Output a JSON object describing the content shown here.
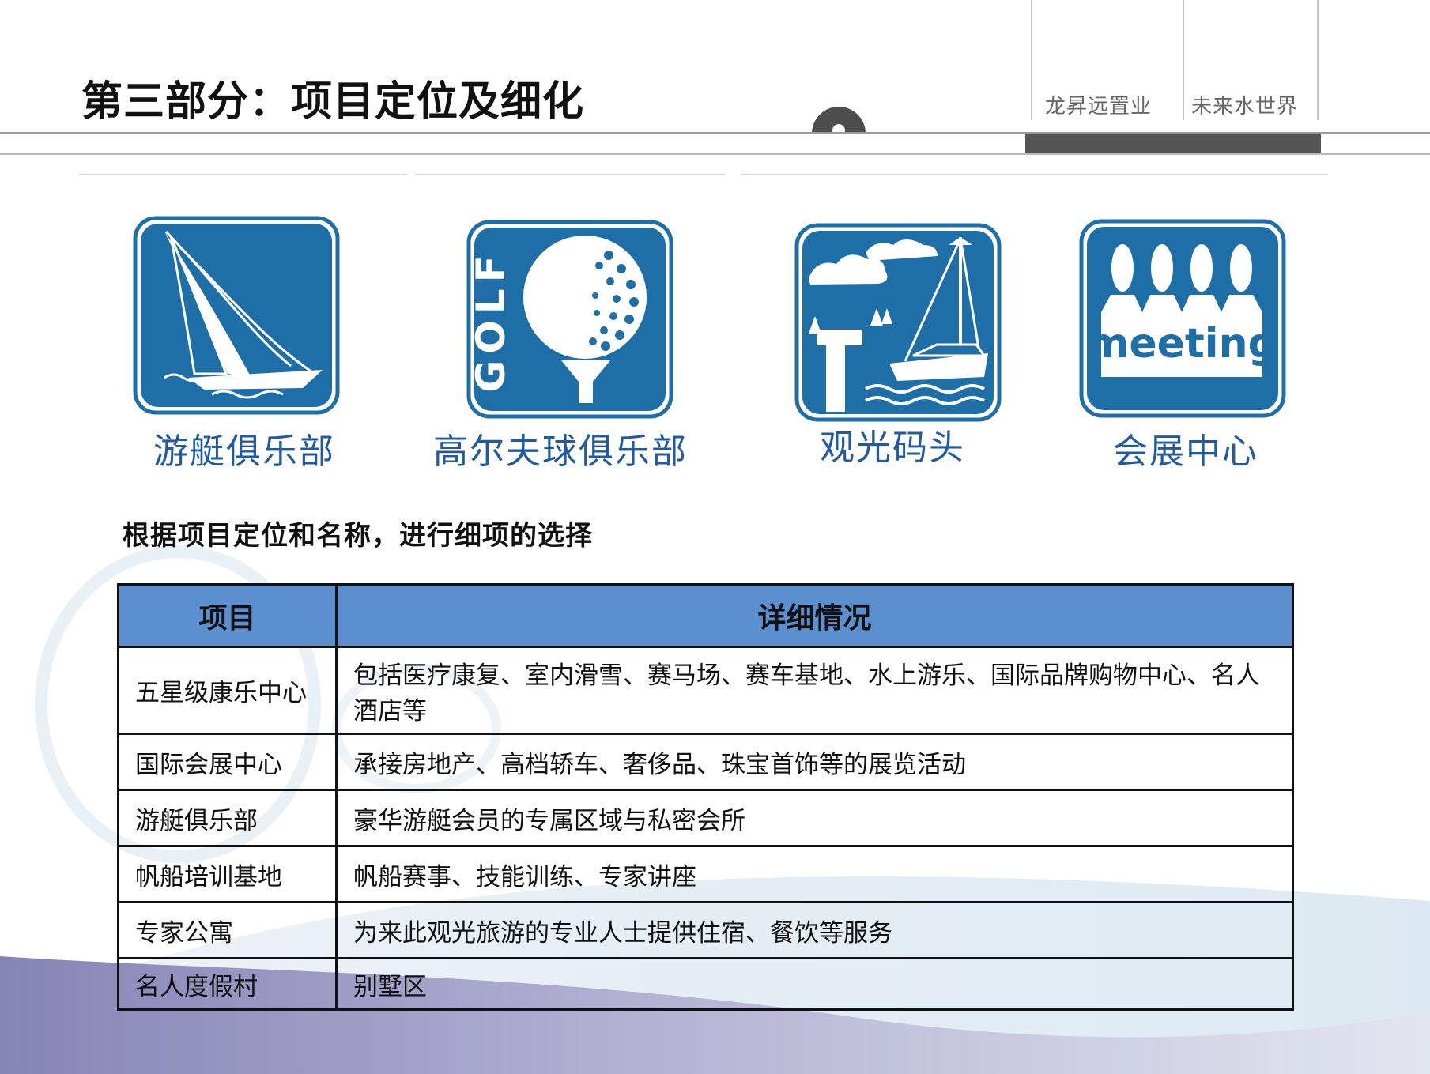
{
  "header": {
    "title": "第三部分：项目定位及细化",
    "brand_left": "龙昇远置业",
    "brand_right": "未来水世界"
  },
  "icons": [
    {
      "label": "游艇俱乐部",
      "icon": "sailboat-icon",
      "text": ""
    },
    {
      "label": "高尔夫球俱乐部",
      "icon": "golf-ball-icon",
      "text": "GOLF"
    },
    {
      "label": "观光码头",
      "icon": "harbor-icon",
      "text": ""
    },
    {
      "label": "会展中心",
      "icon": "meeting-icon",
      "text": "meeting"
    }
  ],
  "subtitle": "根据项目定位和名称，进行细项的选择",
  "table": {
    "headers": [
      "项目",
      "详细情况"
    ],
    "rows": [
      {
        "item": "五星级康乐中心",
        "detail": "包括医疗康复、室内滑雪、赛马场、赛车基地、水上游乐、国际品牌购物中心、名人酒店等"
      },
      {
        "item": "国际会展中心",
        "detail": "承接房地产、高档轿车、奢侈品、珠宝首饰等的展览活动"
      },
      {
        "item": "游艇俱乐部",
        "detail": "豪华游艇会员的专属区域与私密会所"
      },
      {
        "item": "帆船培训基地",
        "detail": "帆船赛事、技能训练、专家讲座"
      },
      {
        "item": "专家公寓",
        "detail": "为来此观光旅游的专业人士提供住宿、餐饮等服务"
      },
      {
        "item": "名人度假村",
        "detail": "别墅区"
      }
    ]
  },
  "colors": {
    "icon_blue": "#1e6fa8",
    "label_blue": "#1f5aa2",
    "table_header": "#5b8fd0",
    "wave_purple": "#8a86b8"
  }
}
